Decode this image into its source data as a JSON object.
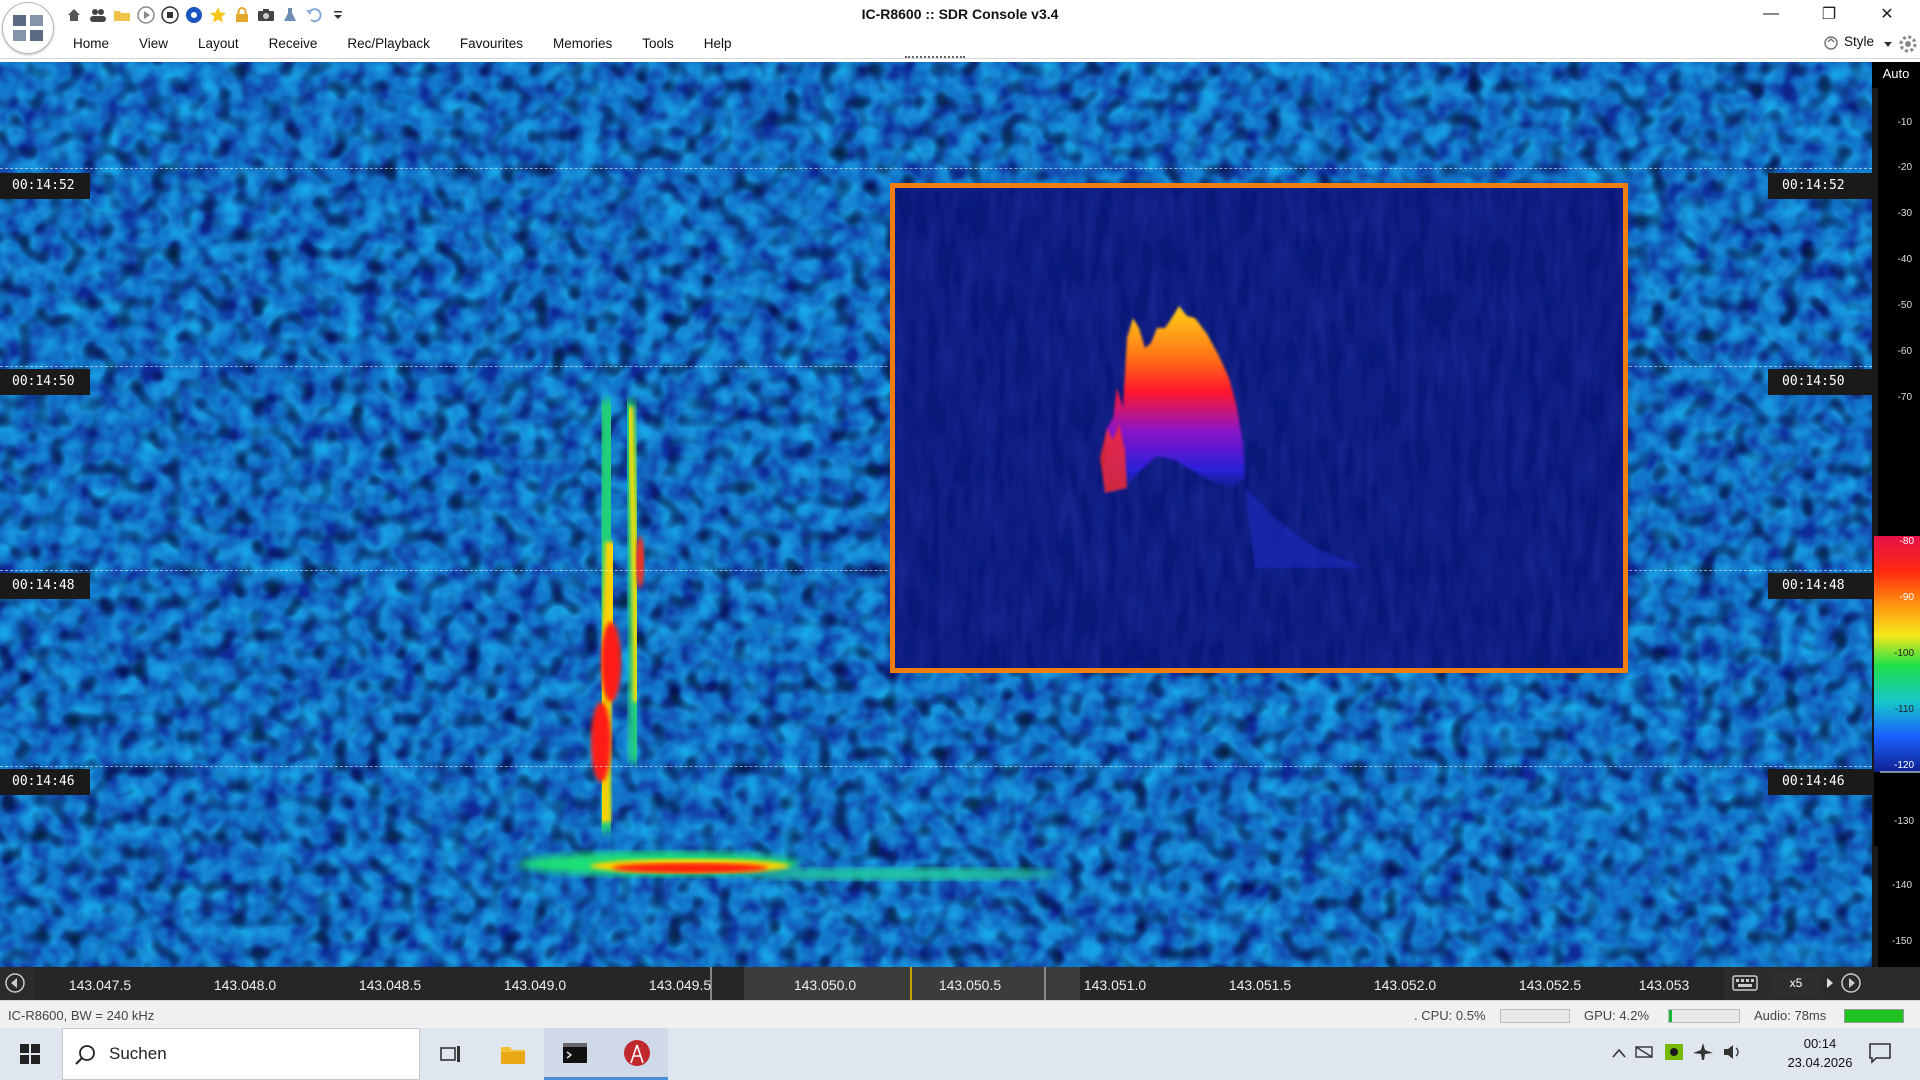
{
  "window": {
    "title": "IC-R8600 :: SDR Console v3.4",
    "quick_access_icons": [
      "home-icon",
      "users-icon",
      "folder-icon",
      "play-icon",
      "stop-icon",
      "record-icon",
      "favourite-star-icon",
      "lock-icon",
      "camera-icon",
      "flask-icon",
      "undo-icon",
      "customize-dropdown-icon"
    ]
  },
  "menu": {
    "items": [
      "Home",
      "View",
      "Layout",
      "Receive",
      "Rec/Playback",
      "Favourites",
      "Memories",
      "Tools",
      "Help"
    ],
    "style_label": "Style"
  },
  "waterfall": {
    "timestamps": [
      "00:14:52",
      "00:14:50",
      "00:14:48",
      "00:14:46"
    ],
    "scale_mode": "Auto",
    "db_ticks": [
      "-10",
      "-20",
      "-30",
      "-40",
      "-50",
      "-60",
      "-70",
      "-80",
      "-90",
      "-100",
      "-110",
      "-120",
      "-130",
      "-140",
      "-150"
    ],
    "colors": {
      "background": "#0f2a9a",
      "noise": "#17a6e8",
      "signal_peak": "#e8101a",
      "inset_border": "#f07d12"
    }
  },
  "frequency_axis": {
    "ticks": [
      "143.047.5",
      "143.048.0",
      "143.048.5",
      "143.049.0",
      "143.049.5",
      "143.050.0",
      "143.050.5",
      "143.051.0",
      "143.051.5",
      "143.052.0",
      "143.052.5",
      "143.053"
    ],
    "zoom": "x5"
  },
  "status": {
    "radio": "IC-R8600, BW = 240 kHz",
    "cpu": ". CPU: 0.5%",
    "gpu": "GPU: 4.2%",
    "audio": "Audio: 78ms",
    "gpu_level": 0.042,
    "audio_level": 1.0
  },
  "taskbar": {
    "search_placeholder": "Suchen",
    "time": "00:14",
    "date": "23.04.2026"
  }
}
